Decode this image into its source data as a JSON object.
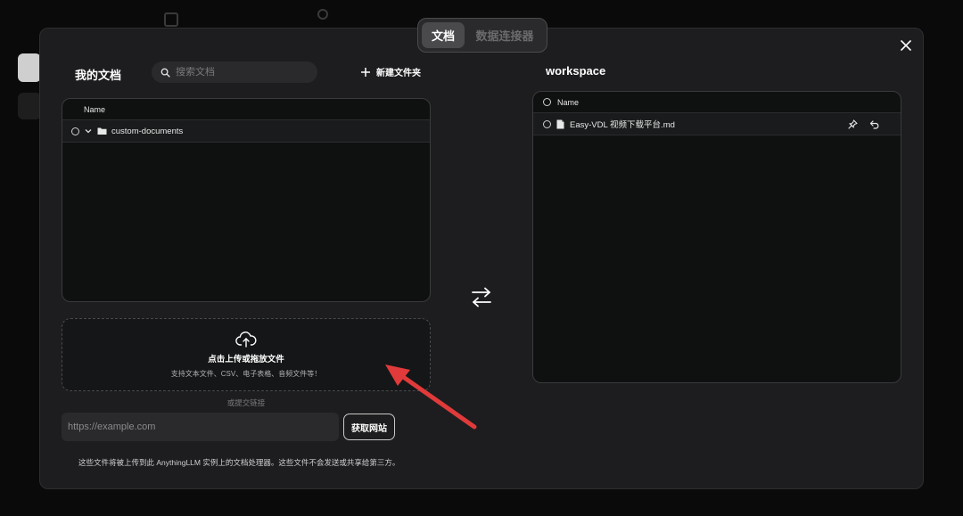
{
  "tabs": [
    {
      "label": "文档",
      "active": true
    },
    {
      "label": "数据连接器",
      "active": false
    }
  ],
  "my_docs": {
    "title": "我的文档",
    "search_placeholder": "搜索文档",
    "new_folder_label": "新建文件夹",
    "column_header": "Name",
    "rows": [
      {
        "name": "custom-documents",
        "type": "folder",
        "expanded": false
      }
    ]
  },
  "upload": {
    "title": "点击上传或拖放文件",
    "subtitle": "支持文本文件、CSV、电子表格、音频文件等！",
    "or_link": "或提交链接",
    "url_placeholder": "https://example.com",
    "fetch_label": "获取网站",
    "disclaimer": "这些文件将被上传到此 AnythingLLM 实例上的文档处理器。这些文件不会发送或共享给第三方。"
  },
  "workspace": {
    "title": "workspace",
    "column_header": "Name",
    "rows": [
      {
        "name": "Easy-VDL 视频下载平台.md",
        "type": "file"
      }
    ]
  },
  "icons": {
    "close": "close-icon",
    "search": "search-icon",
    "plus": "plus-icon",
    "folder": "folder-icon",
    "chevron": "chevron-down-icon",
    "file": "file-icon",
    "pin": "pin-icon",
    "undo": "undo-icon",
    "upload": "cloud-upload-icon",
    "transfer": "transfer-icon"
  },
  "colors": {
    "annotation_arrow": "#e03a3a",
    "modal_bg": "#1d1d1f",
    "panel_bg": "#0f1110"
  }
}
